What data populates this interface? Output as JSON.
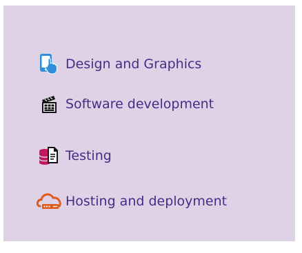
{
  "services": {
    "items": [
      {
        "label": "Design and Graphics",
        "icon": "tablet-touch-icon",
        "icon_color": "#2f8fdc"
      },
      {
        "label": "Software development",
        "icon": "code-window-icon",
        "icon_color": "#111111"
      },
      {
        "label": "Testing",
        "icon": "database-document-icon",
        "icon_color": "#c2185b"
      },
      {
        "label": "Hosting and deployment",
        "icon": "cloud-server-icon",
        "icon_color": "#e05a1c"
      }
    ]
  },
  "colors": {
    "panel_background": "#dfd2e6",
    "label_text": "#4a2a86"
  }
}
